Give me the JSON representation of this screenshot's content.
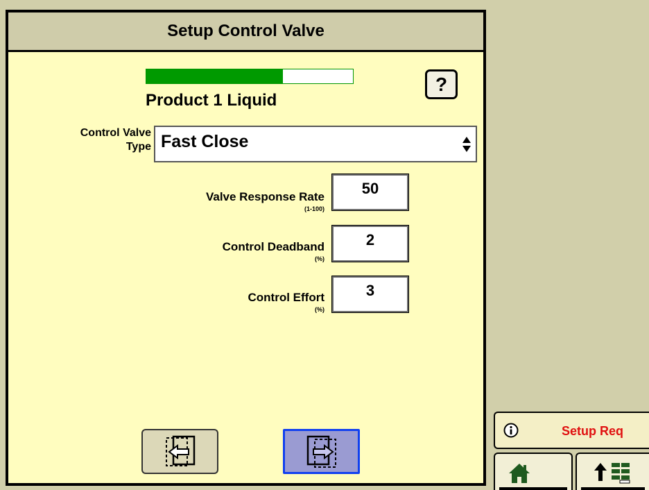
{
  "dialog": {
    "title": "Setup Control Valve",
    "progress_fraction": 0.66,
    "product_title": "Product 1 Liquid",
    "help_label": "?"
  },
  "control_valve_type": {
    "label_line1": "Control Valve",
    "label_line2": "Type",
    "value": "Fast Close"
  },
  "fields": {
    "response_rate": {
      "label": "Valve Response Rate",
      "unit": "(1-100)",
      "value": "50"
    },
    "deadband": {
      "label": "Control Deadband",
      "unit": "(%)",
      "value": "2"
    },
    "effort": {
      "label": "Control Effort",
      "unit": "(%)",
      "value": "3"
    }
  },
  "status": {
    "text": "Setup Req"
  },
  "colors": {
    "background": "#d1cfaa",
    "dialog_bg": "#fffdbf",
    "progress_green": "#009a00",
    "status_red": "#e01010",
    "next_button_bg": "#9a9bd2",
    "next_button_border": "#1040f0"
  },
  "icons": {
    "back": "back-arrow-page-icon",
    "next": "next-arrow-page-icon",
    "info": "info-icon",
    "home": "home-icon",
    "menu": "up-arrow-menu-icon",
    "select_arrows": "sort-arrows-icon"
  }
}
